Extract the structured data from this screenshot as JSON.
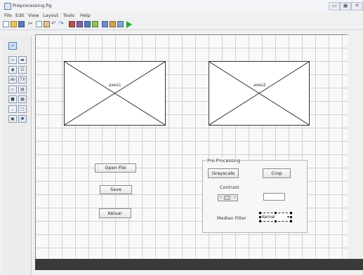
{
  "window": {
    "title": "Preprocessing.fig",
    "controls": [
      "▭",
      "▣",
      "✕"
    ]
  },
  "menubar": [
    "File",
    "Edit",
    "View",
    "Layout",
    "Tools",
    "Help"
  ],
  "toolbar": {
    "run_icon": "play-icon"
  },
  "palette": [
    "pointer",
    "pushbutton",
    "slider",
    "radio",
    "checkbox",
    "edit",
    "text",
    "popup",
    "listbox",
    "toggle",
    "table",
    "axes",
    "panel",
    "buttongroup",
    "activex"
  ],
  "axes1": {
    "label": "axes1"
  },
  "axes2": {
    "label": "axes2"
  },
  "buttons": {
    "open": "Open File",
    "save": "Save",
    "exit": "Keluar"
  },
  "panel": {
    "title": "Pre-Processing",
    "grayscale": "Grayscale",
    "crop": "Crop",
    "contrast_label": "Contrast",
    "median_label": "Median Filter",
    "popup_value": "Kernel"
  },
  "colors": {
    "canvas_grid": "#cfcfcf",
    "run_green": "#2aa52a"
  }
}
